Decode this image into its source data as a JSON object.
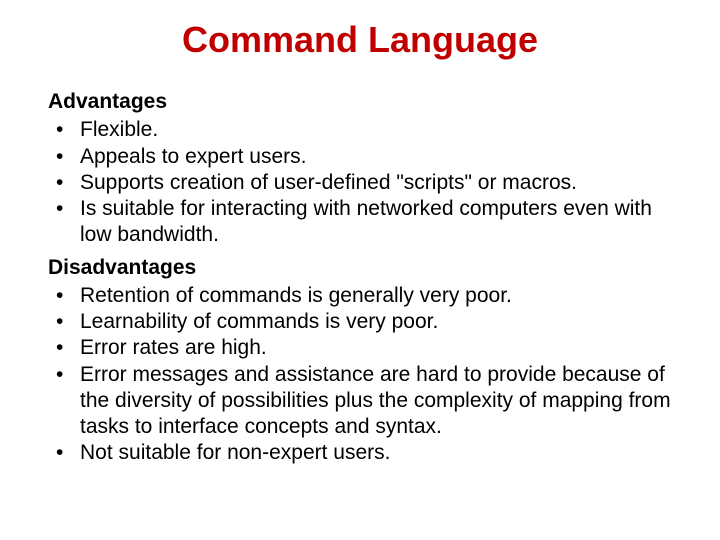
{
  "title": "Command Language",
  "advantages_heading": "Advantages",
  "advantages": {
    "0": "Flexible.",
    "1": "Appeals to expert users.",
    "2": "Supports creation of user-defined \"scripts\" or macros.",
    "3": "Is suitable for interacting with networked computers even with low bandwidth."
  },
  "disadvantages_heading": "Disadvantages",
  "disadvantages": {
    "0": "Retention of commands is generally very poor.",
    "1": "Learnability of commands is very poor.",
    "2": "Error rates are high.",
    "3": "Error messages and assistance are hard to provide because of the diversity of possibilities plus the complexity of mapping from tasks to interface concepts and syntax.",
    "4": "Not suitable for non-expert users."
  }
}
